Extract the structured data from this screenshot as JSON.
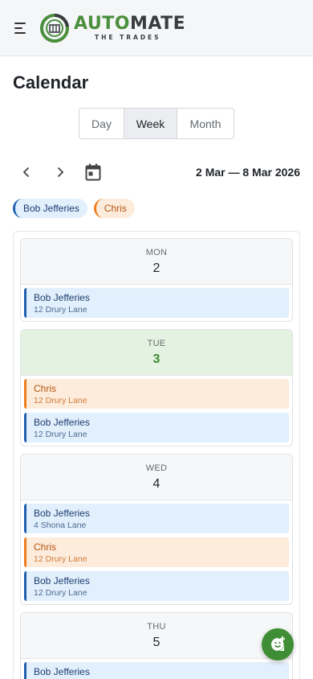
{
  "brand": {
    "word_part1": "AUTO",
    "word_part2": "MATE",
    "tagline": "THE TRADES",
    "colors": {
      "green": "#4a8f3c",
      "dark": "#3a3d40"
    }
  },
  "page": {
    "title": "Calendar"
  },
  "view_toggle": {
    "options": [
      "Day",
      "Week",
      "Month"
    ],
    "selected": "Week"
  },
  "navigation": {
    "prev_icon": "chevron-left-icon",
    "next_icon": "chevron-right-icon",
    "today_icon": "calendar-icon",
    "date_range": "2 Mar — 8 Mar 2026"
  },
  "staff_filters": [
    {
      "name": "Bob Jefferies",
      "color": "#1f5fb0"
    },
    {
      "name": "Chris",
      "color": "#ef7c1b"
    }
  ],
  "days": [
    {
      "name": "MON",
      "number": "2",
      "today": false,
      "events": [
        {
          "staff": "Bob Jefferies",
          "address": "12 Drury Lane",
          "color": "bob"
        }
      ]
    },
    {
      "name": "TUE",
      "number": "3",
      "today": true,
      "events": [
        {
          "staff": "Chris",
          "address": "12 Drury Lane",
          "color": "chris"
        },
        {
          "staff": "Bob Jefferies",
          "address": "12 Drury Lane",
          "color": "bob"
        }
      ]
    },
    {
      "name": "WED",
      "number": "4",
      "today": false,
      "events": [
        {
          "staff": "Bob Jefferies",
          "address": "4 Shona Lane",
          "color": "bob"
        },
        {
          "staff": "Chris",
          "address": "12 Drury Lane",
          "color": "chris"
        },
        {
          "staff": "Bob Jefferies",
          "address": "12 Drury Lane",
          "color": "bob"
        }
      ]
    },
    {
      "name": "THU",
      "number": "5",
      "today": false,
      "events": [
        {
          "staff": "Bob Jefferies",
          "address": "",
          "color": "bob"
        }
      ]
    }
  ],
  "fab": {
    "icon": "add-event-icon",
    "color": "#3f8e35"
  }
}
